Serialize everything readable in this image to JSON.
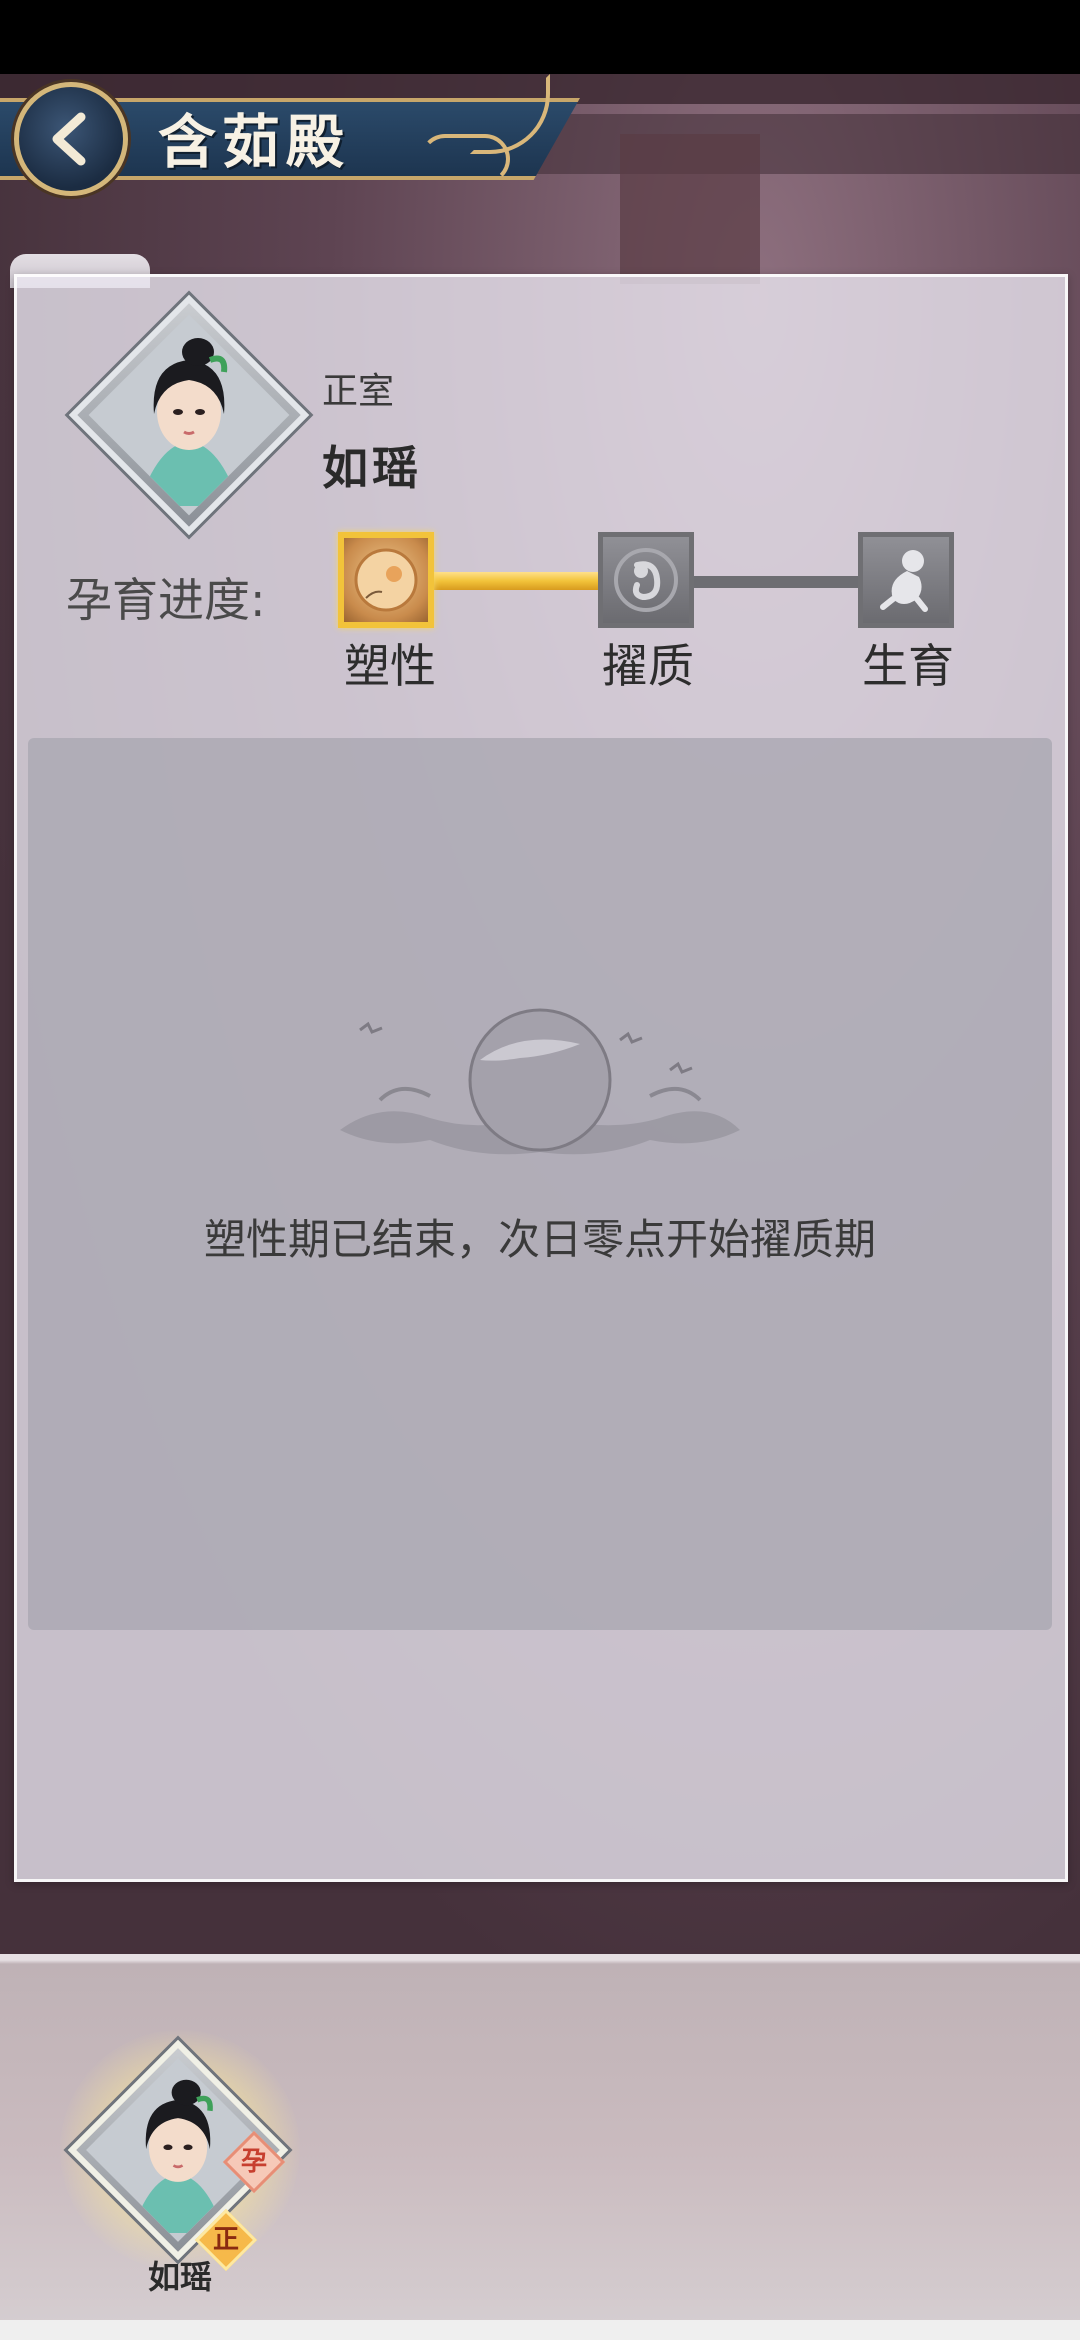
{
  "header": {
    "title": "含茹殿",
    "back_icon": "chevron-left-icon"
  },
  "consort": {
    "role": "正室",
    "name": "如瑶"
  },
  "progress": {
    "label": "孕育进度:",
    "current_stage_index": 0,
    "stages": [
      {
        "label": "塑性",
        "icon": "egg-cell-icon",
        "active": true
      },
      {
        "label": "擢质",
        "icon": "embryo-icon",
        "active": false
      },
      {
        "label": "生育",
        "icon": "baby-icon",
        "active": false
      }
    ]
  },
  "content": {
    "message": "塑性期已结束，次日零点开始擢质期"
  },
  "bottom_list": {
    "items": [
      {
        "name": "如瑶",
        "badge_pregnant": "孕",
        "badge_role": "正",
        "selected": true
      }
    ]
  },
  "colors": {
    "accent_gold": "#f2c33a",
    "header_blue": "#1d3550",
    "inactive_gray": "#6d6d72"
  }
}
